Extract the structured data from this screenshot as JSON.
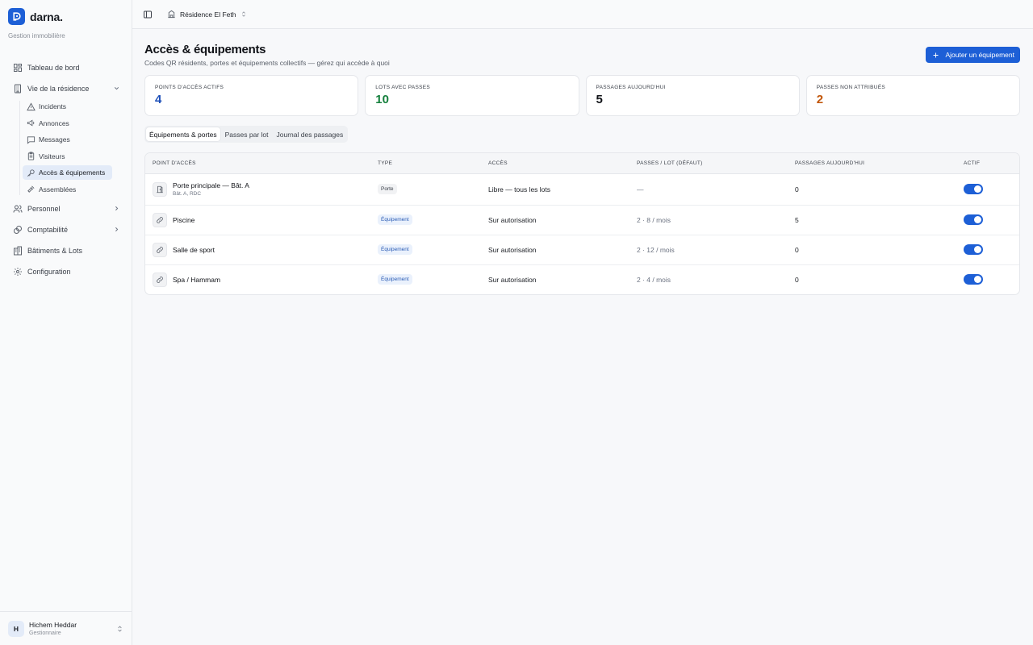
{
  "brand": {
    "name": "darna.",
    "subtitle": "Gestion immobilière"
  },
  "nav": {
    "items": [
      {
        "label": "Tableau de bord",
        "icon": "dashboard-icon"
      },
      {
        "label": "Vie de la résidence",
        "icon": "building-icon",
        "expanded": true
      },
      {
        "label": "Personnel",
        "icon": "users-icon"
      },
      {
        "label": "Comptabilité",
        "icon": "coins-icon"
      },
      {
        "label": "Bâtiments & Lots",
        "icon": "buildings-icon"
      },
      {
        "label": "Configuration",
        "icon": "gear-icon"
      }
    ],
    "subitems": [
      {
        "label": "Incidents",
        "icon": "warning-icon"
      },
      {
        "label": "Annonces",
        "icon": "megaphone-icon"
      },
      {
        "label": "Messages",
        "icon": "message-icon"
      },
      {
        "label": "Visiteurs",
        "icon": "clipboard-icon"
      },
      {
        "label": "Accès & équipements",
        "icon": "key-icon",
        "active": true
      },
      {
        "label": "Assemblées",
        "icon": "gavel-icon"
      }
    ]
  },
  "user": {
    "initial": "H",
    "name": "Hichem Heddar",
    "role": "Gestionnaire"
  },
  "topbar": {
    "residence": "Résidence El Feth"
  },
  "page": {
    "title": "Accès & équipements",
    "subtitle": "Codes QR résidents, portes et équipements collectifs — gérez qui accède à quoi",
    "add_button": "Ajouter un équipement"
  },
  "stats": [
    {
      "label": "Points d'accès actifs",
      "value": "4",
      "color": "#1d4fb8"
    },
    {
      "label": "Lots avec passes",
      "value": "10",
      "color": "#15803d"
    },
    {
      "label": "Passages aujourd'hui",
      "value": "5",
      "color": "#111318"
    },
    {
      "label": "Passes non attribués",
      "value": "2",
      "color": "#c2570c"
    }
  ],
  "tabs": [
    "Équipements & portes",
    "Passes par lot",
    "Journal des passages"
  ],
  "table": {
    "headers": [
      "Point d'accès",
      "Type",
      "Accès",
      "Passes / lot (défaut)",
      "Passages aujourd'hui",
      "Actif"
    ],
    "rows": [
      {
        "name": "Porte principale — Bât. A",
        "location": "Bât. A, RDC",
        "type": "Porte",
        "access": "Libre — tous les lots",
        "passes": "—",
        "today": "0",
        "active": true,
        "icon": "door-icon"
      },
      {
        "name": "Piscine",
        "location": "",
        "type": "Équipement",
        "access": "Sur autorisation",
        "passes": "2 · 8 / mois",
        "today": "5",
        "active": true,
        "icon": "link-icon"
      },
      {
        "name": "Salle de sport",
        "location": "",
        "type": "Équipement",
        "access": "Sur autorisation",
        "passes": "2 · 12 / mois",
        "today": "0",
        "active": true,
        "icon": "link-icon"
      },
      {
        "name": "Spa / Hammam",
        "location": "",
        "type": "Équipement",
        "access": "Sur autorisation",
        "passes": "2 · 4 / mois",
        "today": "0",
        "active": true,
        "icon": "link-icon"
      }
    ]
  }
}
